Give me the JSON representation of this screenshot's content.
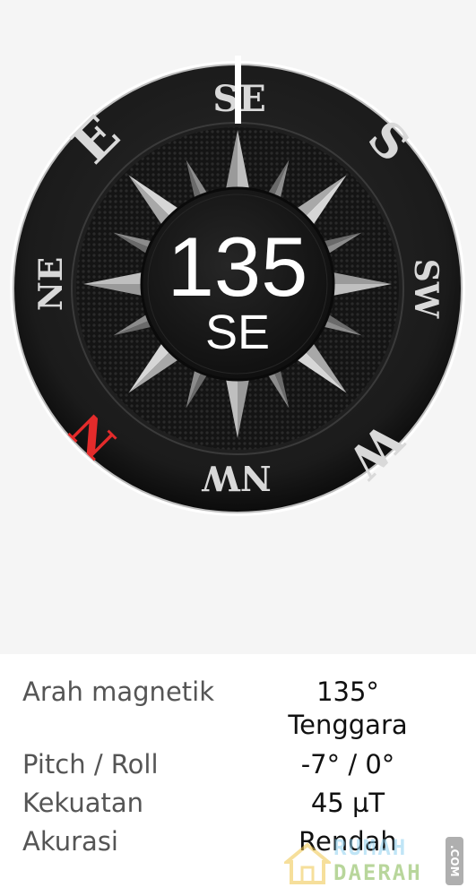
{
  "compass": {
    "heading_degrees": "135",
    "heading_direction": "SE",
    "ring_labels": {
      "top": "SE",
      "upper_right": "S",
      "right": "SW",
      "lower_right": "W",
      "bottom": "NW",
      "lower_left": "N",
      "left": "NE",
      "upper_left": "E"
    },
    "north_color": "#e32b2b",
    "label_color": "#d9d9d9"
  },
  "info": {
    "rows": [
      {
        "label": "Arah magnetik",
        "value": "135°",
        "value2": "Tenggara"
      },
      {
        "label": "Pitch / Roll",
        "value": "-7° / 0°"
      },
      {
        "label": "Kekuatan",
        "value": "45 µT"
      },
      {
        "label": "Akurasi",
        "value": "Rendah"
      }
    ]
  },
  "watermark": {
    "line1": "RUMAH",
    "line2": "DAERAH",
    "suffix": ".COM"
  }
}
